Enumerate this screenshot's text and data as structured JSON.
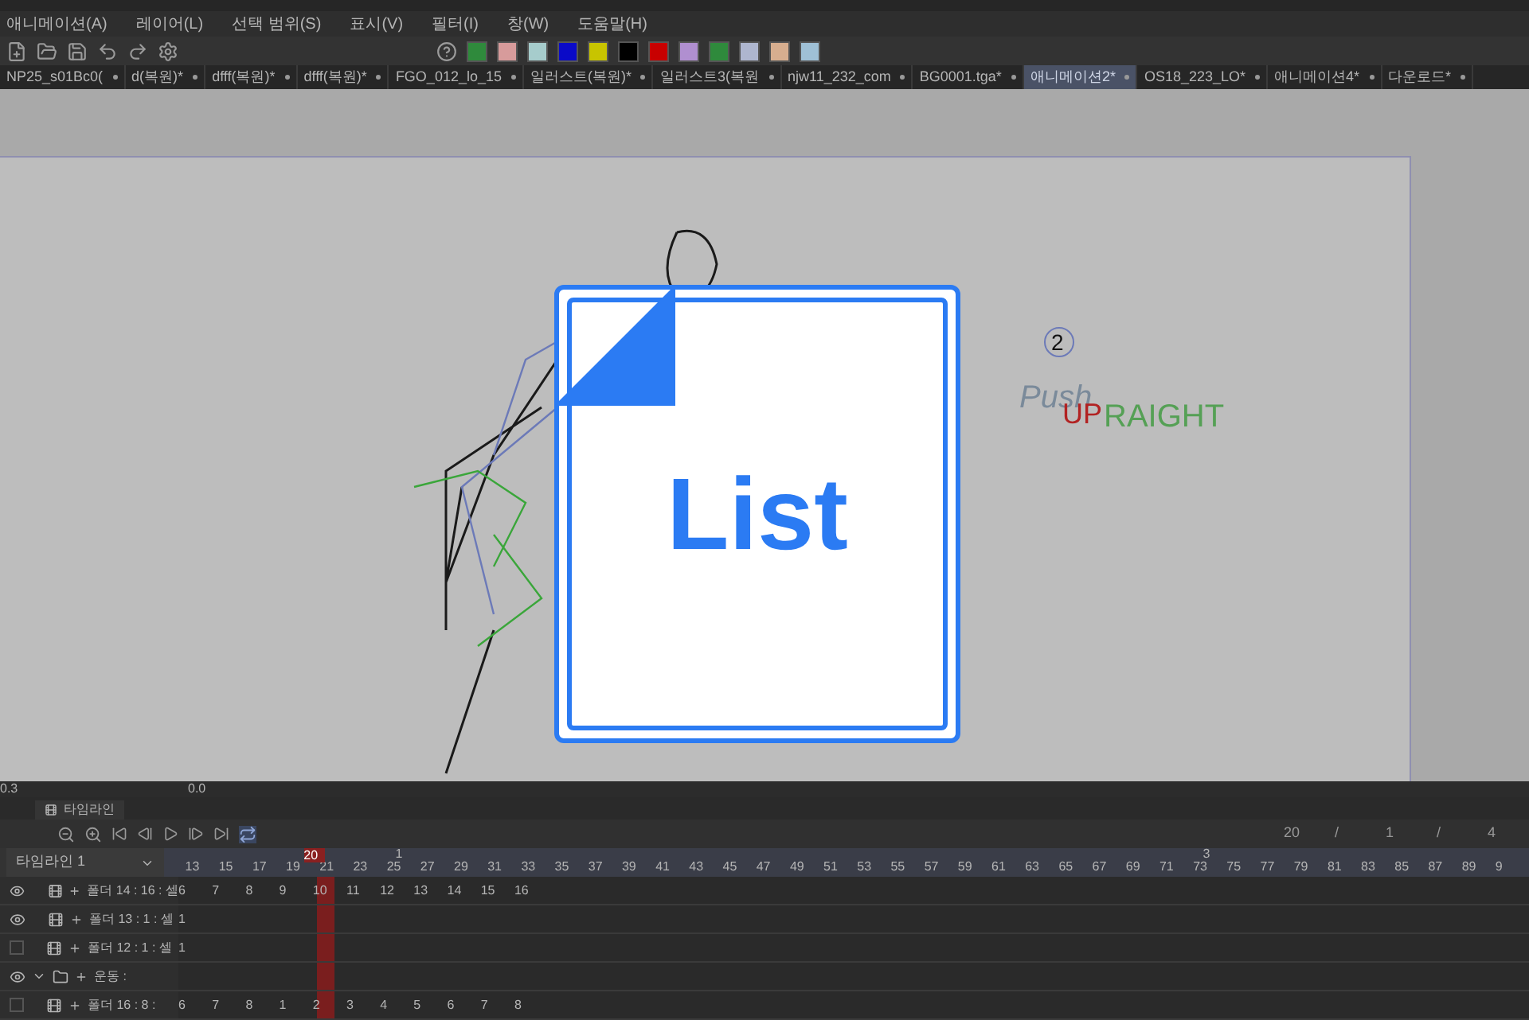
{
  "menu": [
    "애니메이션(A)",
    "레이어(L)",
    "선택 범위(S)",
    "표시(V)",
    "필터(I)",
    "창(W)",
    "도움말(H)"
  ],
  "swatches": [
    {
      "color": "#2f8a3c"
    },
    {
      "color": "#d79b9b"
    },
    {
      "color": "#a6cccc"
    },
    {
      "color": "#0a0ac8"
    },
    {
      "color": "#c8c400"
    },
    {
      "color": "#000000"
    },
    {
      "color": "#c80000"
    },
    {
      "color": "#b08fd0"
    },
    {
      "color": "#2f8a3c"
    },
    {
      "color": "#aeb6cf"
    },
    {
      "color": "#d7ae8f"
    },
    {
      "color": "#9fc0d6"
    }
  ],
  "tabs": [
    {
      "label": "NP25_s01Bc0(",
      "selected": false
    },
    {
      "label": "d(복원)*",
      "selected": false
    },
    {
      "label": "dfff(복원)*",
      "selected": false
    },
    {
      "label": "dfff(복원)*",
      "selected": false
    },
    {
      "label": "FGO_012_lo_15",
      "selected": false
    },
    {
      "label": "일러스트(복원)*",
      "selected": false
    },
    {
      "label": "일러스트3(복원",
      "selected": false
    },
    {
      "label": "njw11_232_com",
      "selected": false
    },
    {
      "label": "BG0001.tga*",
      "selected": false
    },
    {
      "label": "애니메이션2*",
      "selected": true
    },
    {
      "label": "OS18_223_LO*",
      "selected": false
    },
    {
      "label": "애니메이션4*",
      "selected": false
    },
    {
      "label": "다운로드*",
      "selected": false
    }
  ],
  "canvas_notes": [
    "2",
    "Push",
    "UP",
    "RAIGHT"
  ],
  "status_bar": {
    "zoom": "0.3",
    "angle": "0.0"
  },
  "timeline": {
    "tab": "타임라인",
    "selector": "타임라인 1",
    "counter": [
      "20",
      "/",
      "1",
      "/",
      "4"
    ],
    "ruler": [
      "13",
      "15",
      "17",
      "19",
      "21",
      "23",
      "25",
      "27",
      "29",
      "31",
      "33",
      "35",
      "37",
      "39",
      "41",
      "43",
      "45",
      "47",
      "49",
      "51",
      "53",
      "55",
      "57",
      "59",
      "61",
      "63",
      "65",
      "67",
      "69",
      "71",
      "73",
      "75",
      "77",
      "79",
      "81",
      "83",
      "85",
      "87",
      "89",
      "9"
    ],
    "current_frame": "20",
    "markers": [
      "1",
      "3"
    ],
    "layers": [
      {
        "kind": "cell",
        "name": "폴더 14 : 16 : 셀",
        "visible": true,
        "cells": [
          "6",
          "7",
          "8",
          "9",
          "10",
          "11",
          "12",
          "13",
          "14",
          "15",
          "16"
        ]
      },
      {
        "kind": "cell",
        "name": "폴더 13 : 1 : 셀",
        "visible": true,
        "cells": [
          "1"
        ]
      },
      {
        "kind": "cell",
        "name": "폴더 12 : 1 : 셀",
        "visible": false,
        "cells": [
          "1"
        ]
      },
      {
        "kind": "folder",
        "name": "운동 :",
        "visible": true,
        "expanded": true
      },
      {
        "kind": "cell",
        "name": "폴더 16 : 8 :",
        "visible": false,
        "cells": [
          "6",
          "7",
          "8",
          "1",
          "2",
          "3",
          "4",
          "5",
          "6",
          "7",
          "8"
        ]
      }
    ]
  },
  "overlay": {
    "label": "List"
  }
}
